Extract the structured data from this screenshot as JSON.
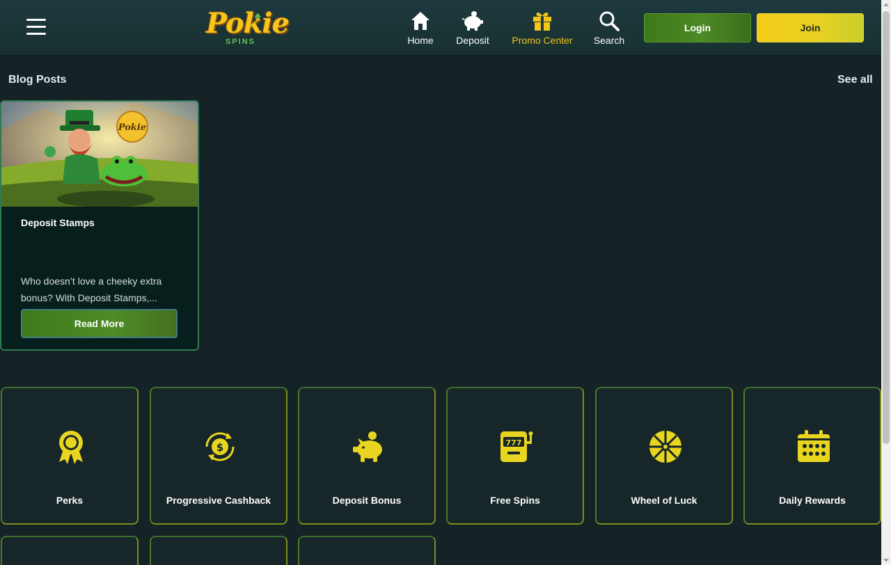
{
  "header": {
    "logo_text": "Pokie",
    "logo_subtext": "SPINS",
    "nav": [
      {
        "label": "Home",
        "icon": "home-icon",
        "active": false
      },
      {
        "label": "Deposit",
        "icon": "piggy-bank-icon",
        "active": false
      },
      {
        "label": "Promo Center",
        "icon": "gift-icon",
        "active": true
      },
      {
        "label": "Search",
        "icon": "search-icon",
        "active": false
      }
    ],
    "login_label": "Login",
    "join_label": "Join"
  },
  "blog": {
    "section_title": "Blog Posts",
    "see_all_label": "See all",
    "posts": [
      {
        "title": "Deposit Stamps",
        "excerpt": "Who doesn’t love a cheeky extra bonus? With Deposit Stamps,...",
        "button_label": "Read More",
        "image_badge_text": "Pokie"
      }
    ]
  },
  "promos": [
    {
      "label": "Perks",
      "icon": "award-ribbon-icon"
    },
    {
      "label": "Progressive Cashback",
      "icon": "cashback-coin-icon"
    },
    {
      "label": "Deposit Bonus",
      "icon": "piggy-bank-icon"
    },
    {
      "label": "Free Spins",
      "icon": "slot-machine-icon"
    },
    {
      "label": "Wheel of Luck",
      "icon": "wheel-icon"
    },
    {
      "label": "Daily Rewards",
      "icon": "calendar-icon"
    }
  ],
  "colors": {
    "background": "#152226",
    "header": "#1e3a3f",
    "accent_yellow": "#f5c518",
    "accent_green": "#4c8a24",
    "card_bg": "#071f1c"
  }
}
